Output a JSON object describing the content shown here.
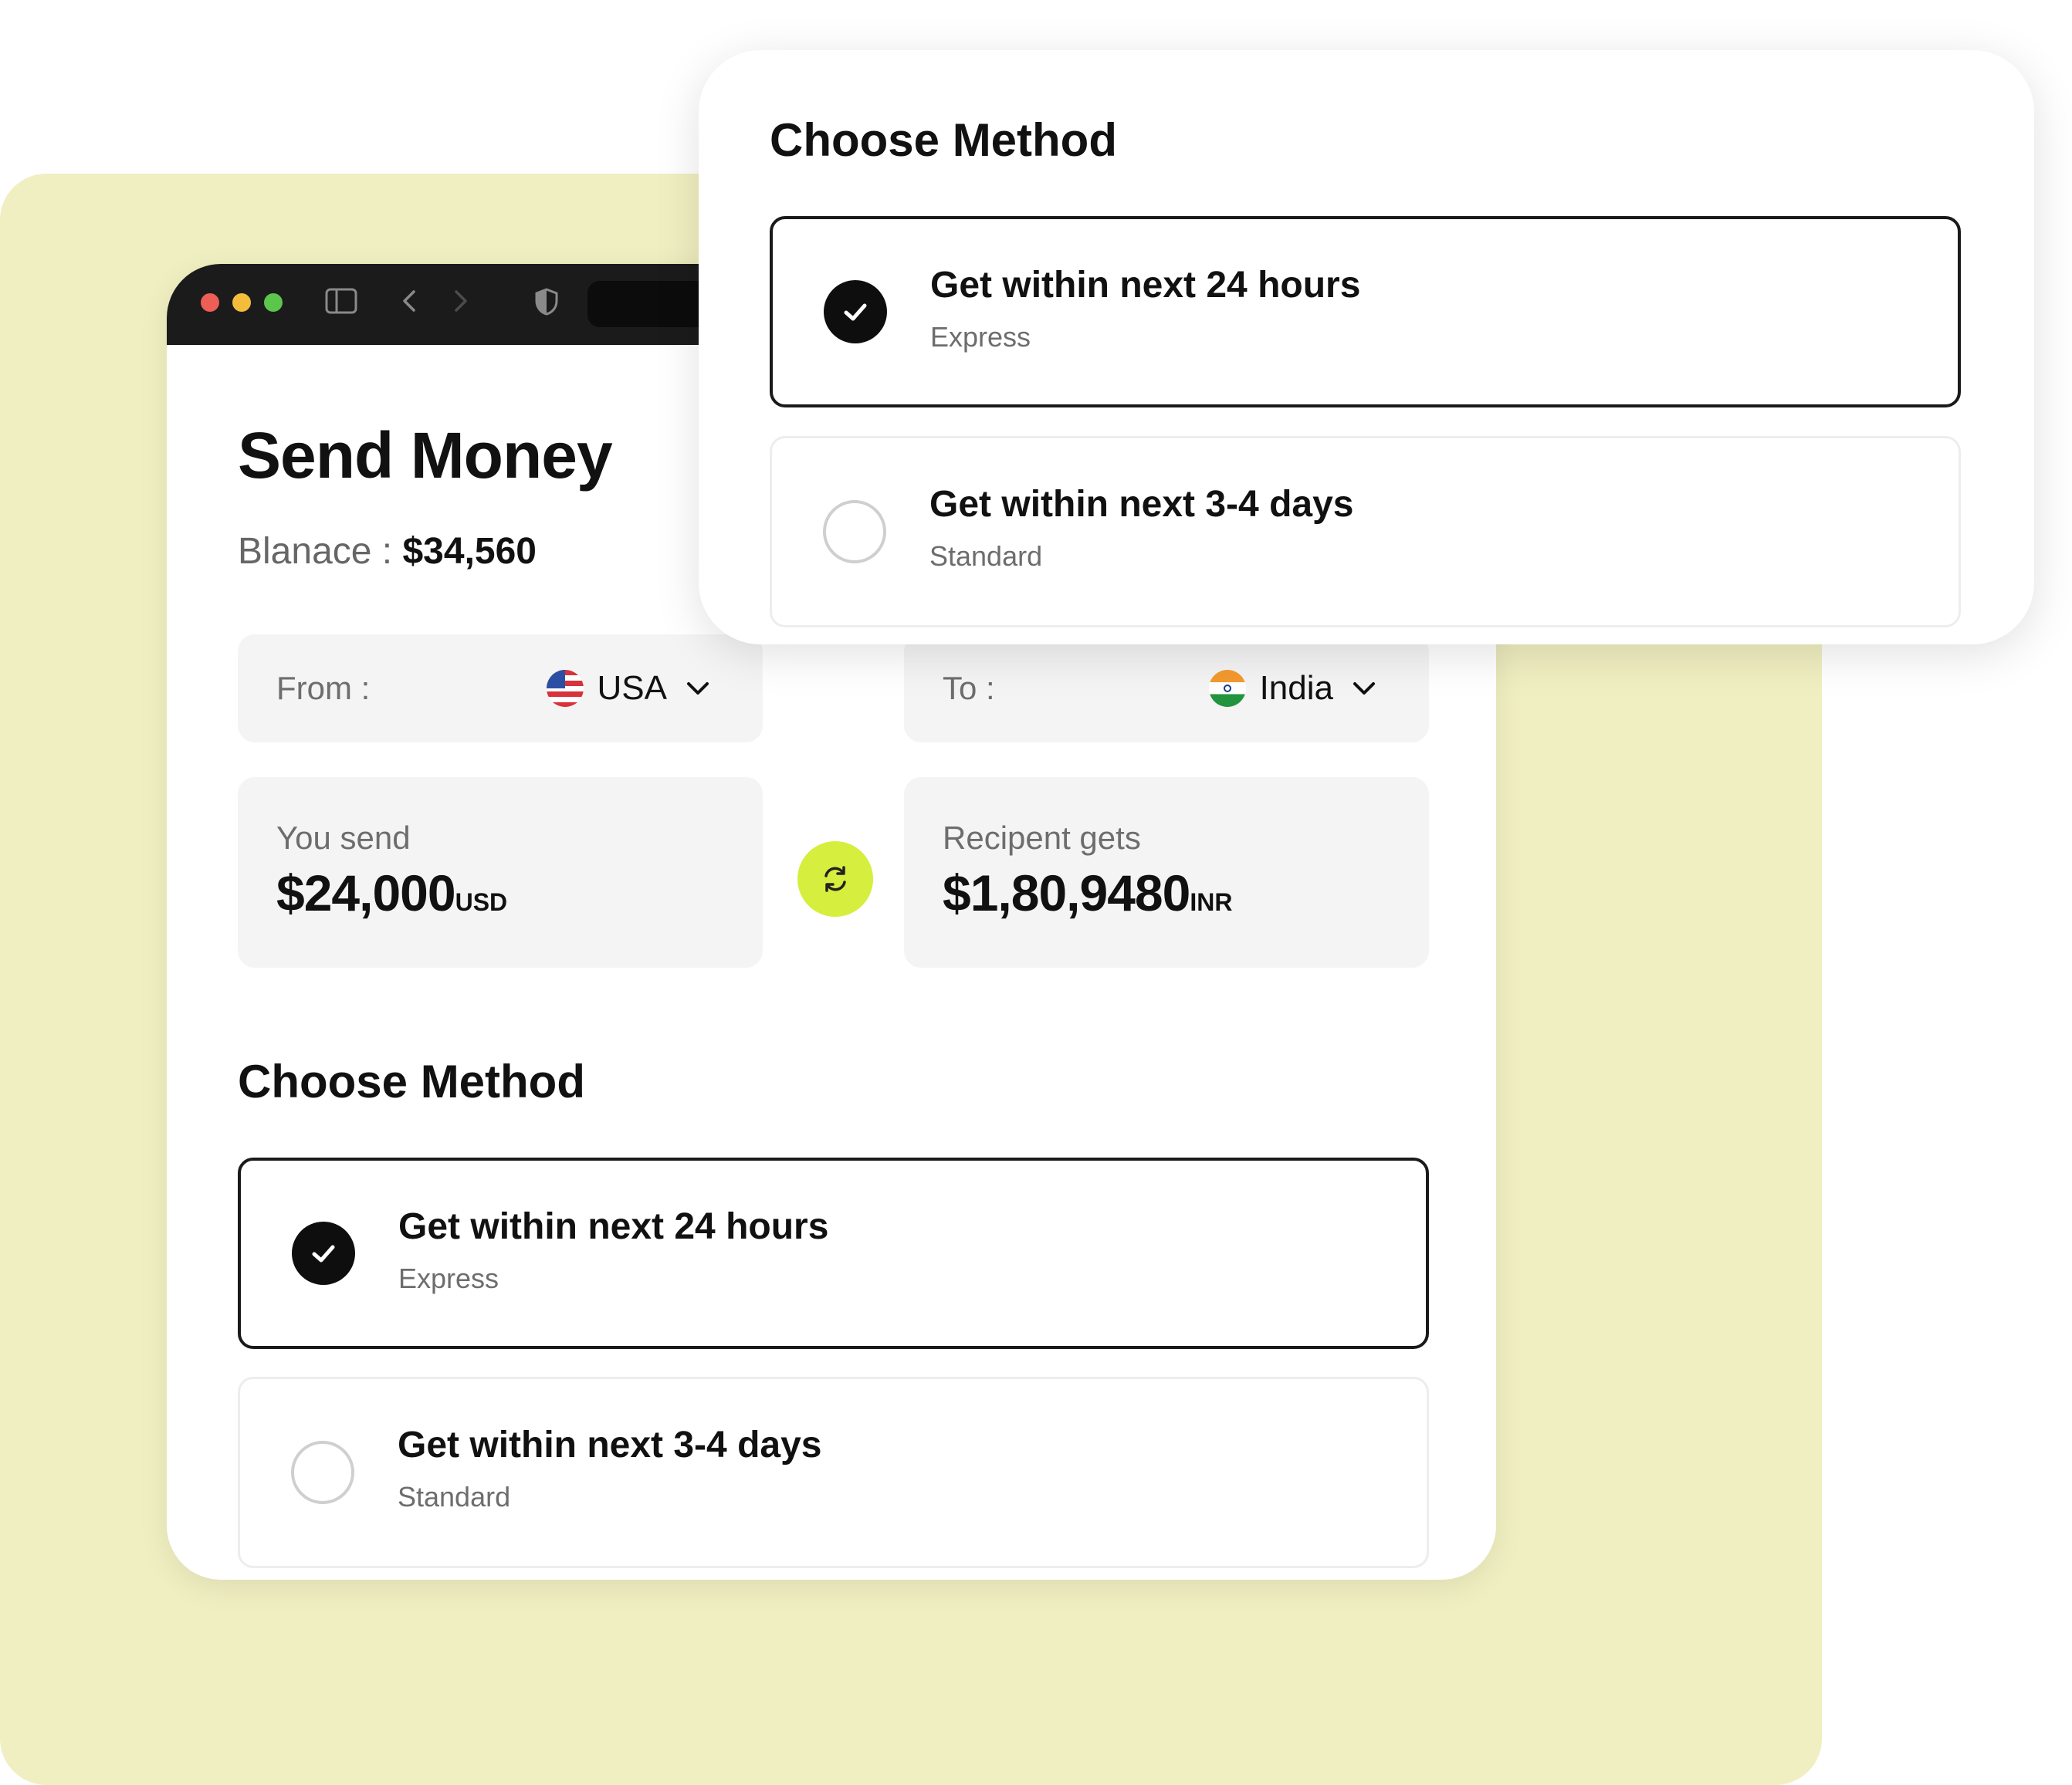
{
  "page": {
    "title": "Send Money"
  },
  "balance": {
    "label": "Blanace :",
    "value": "$34,560"
  },
  "from": {
    "label": "From :",
    "country": "USA",
    "flag_icon": "us-flag-icon"
  },
  "to": {
    "label": "To :",
    "country": "India",
    "flag_icon": "india-flag-icon"
  },
  "send": {
    "label": "You send",
    "amount": "$24,000",
    "currency": "USD"
  },
  "receive": {
    "label": "Recipent gets",
    "amount": "$1,80,9480",
    "currency": "INR"
  },
  "method": {
    "title": "Choose Method",
    "options": [
      {
        "title": "Get within next 24 hours",
        "subtitle": "Express",
        "selected": true
      },
      {
        "title": "Get within next 3-4 days",
        "subtitle": "Standard",
        "selected": false
      }
    ]
  },
  "popup": {
    "title": "Choose Method",
    "options": [
      {
        "title": "Get within next 24 hours",
        "subtitle": "Express",
        "selected": true
      },
      {
        "title": "Get within next 3-4 days",
        "subtitle": "Standard",
        "selected": false
      }
    ]
  },
  "colors": {
    "backdrop": "#f0efc1",
    "accent": "#d6ee3d",
    "titlebar": "#1b1b1b"
  }
}
